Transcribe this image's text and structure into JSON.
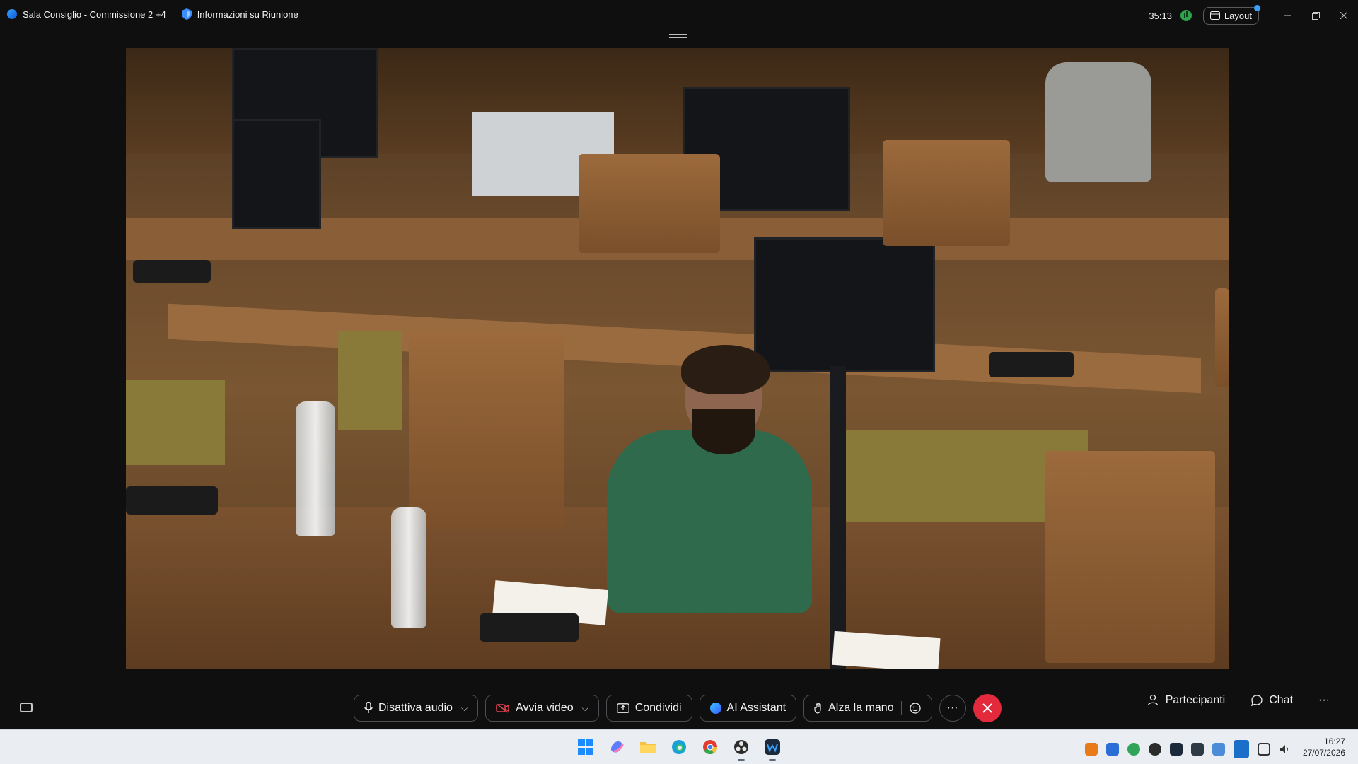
{
  "window": {
    "title": "Sala Consiglio - Commissione 2 +4",
    "meeting_info": "Informazioni su Riunione",
    "timer": "35:13",
    "layout_label": "Layout"
  },
  "controls": {
    "mute_label": "Disattiva audio",
    "video_label": "Avvia video",
    "share_label": "Condividi",
    "ai_label": "AI Assistant",
    "raise_hand_label": "Alza la mano",
    "more_label": "···",
    "participants_label": "Partecipanti",
    "chat_label": "Chat",
    "overflow_label": "···"
  },
  "taskbar": {
    "apps": [
      "windows-start",
      "copilot",
      "file-explorer",
      "edge",
      "chrome",
      "obs",
      "webex"
    ],
    "time": "16:27",
    "date": "27/07/2026"
  },
  "colors": {
    "background": "#0f0f10",
    "end_call": "#e22a3c",
    "video_off": "#e0424f",
    "accent": "#3aa0ff"
  }
}
